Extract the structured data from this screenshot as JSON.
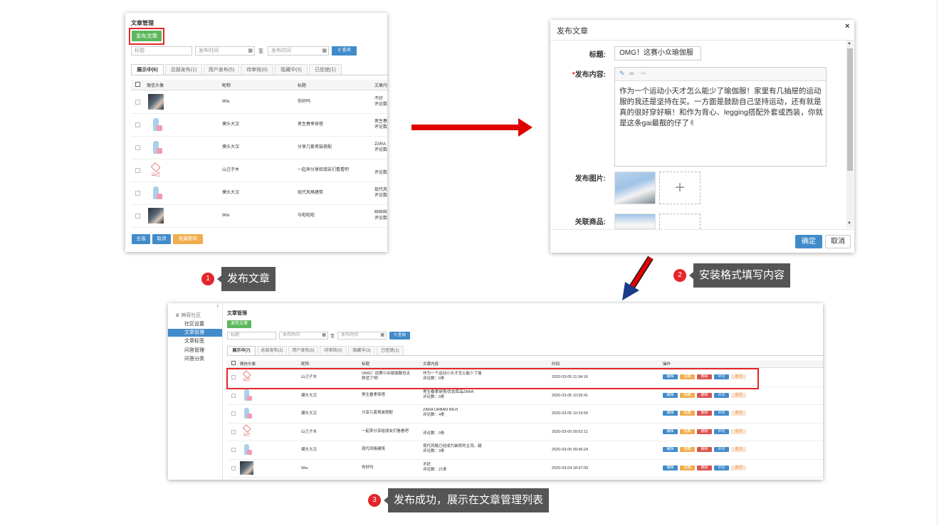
{
  "shot1": {
    "title": "文章管理",
    "publish_btn": "发布文章",
    "search_title_placeholder": "标题",
    "date_from_placeholder": "发布时间",
    "date_sep": "至",
    "date_to_placeholder": "发布时间",
    "query_btn": "查询",
    "tabs": [
      "展示中(6)",
      "总部发布(1)",
      "用户发布(5)",
      "待审核(0)",
      "隐藏中(3)",
      "已拒绝(1)"
    ],
    "headers": [
      "微信头像",
      "昵称",
      "标题",
      "文章内"
    ],
    "rows": [
      {
        "nick": "Ww.",
        "title": "你好吗",
        "content": "不好",
        "content2": "评论数"
      },
      {
        "nick": "摸头大汉",
        "title": "男生春季穿搭",
        "content": "男生春",
        "content2": "评论数"
      },
      {
        "nick": "摸头大汉",
        "title": "分享几套男装搭配",
        "content": "ZARA",
        "content2": "评论数"
      },
      {
        "nick": "山己子木",
        "title": "一起来分享给朋友们看看吧",
        "content": "",
        "content2": "评论数"
      },
      {
        "nick": "摸头大汉",
        "title": "现代风格建筑",
        "content": "现代风",
        "content2": "评论数"
      },
      {
        "nick": "Ww.",
        "title": "与啦啦啦",
        "content": "哔哔哔",
        "content2": "评论数"
      }
    ],
    "select_all": "全选",
    "cancel": "取消",
    "batch_delete": "批量删除"
  },
  "dialog": {
    "title": "发布文章",
    "close": "×",
    "title_label": "标题:",
    "title_value": "OMG！这赛小众瑜伽服",
    "content_label": "发布内容:",
    "content_req": "*",
    "content_text": "作为一个运动小天才怎么能少了瑜伽服！家里有几抽屉的运动服的我还是坚持在买。一方面是鼓励自己坚持运动，还有就是真的很好穿好嘛！和作为背心、legging搭配外套或西装，你就是这条gai最靓的仔了✌",
    "image_label": "发布图片:",
    "goods_label": "关联商品:",
    "plus": "+",
    "ok": "确定",
    "cancel": "取消"
  },
  "steps": [
    {
      "num": "1",
      "text": "发布文章"
    },
    {
      "num": "2",
      "text": "安装格式填写内容"
    },
    {
      "num": "3",
      "text": "发布成功，展示在文章管理列表"
    }
  ],
  "shot3": {
    "sidebar_header": "神奇社区",
    "sidebar_items": [
      "社区设置",
      "文章管理",
      "文章标签",
      "问答管理",
      "问答分类"
    ],
    "title": "文章管理",
    "publish_btn": "发布文章",
    "search_title_placeholder": "标题",
    "date_from_placeholder": "发布时间",
    "date_sep": "至",
    "date_to_placeholder": "发布时间",
    "query_btn": "查询",
    "tabs": [
      "展示中(7)",
      "总部发布(2)",
      "用户发布(5)",
      "待审核(0)",
      "隐藏中(3)",
      "已拒绝(1)"
    ],
    "headers": [
      "微信头像",
      "昵称",
      "标题",
      "文章内容",
      "时间",
      "操作"
    ],
    "actions": [
      "编辑",
      "隐藏",
      "删除",
      "评论",
      "置顶"
    ],
    "rows": [
      {
        "nick": "山己子木",
        "title": "OMG！这赛小众瑜伽服也太",
        "title2": "舒适了吧!",
        "content": "作为一个运动小天才怎么能少了瑜",
        "content2": "评论数：0条",
        "time": "2020-03-05 11:34:16"
      },
      {
        "nick": "摸头大汉",
        "title": "男生春季穿搭",
        "title2": "",
        "content": "男生春季穿搭/优衣库品ZARA",
        "content2": "评论数：0条",
        "time": "2020-03-05 10:35:41"
      },
      {
        "nick": "摸头大汉",
        "title": "分享几套男装搭配",
        "title2": "",
        "content": "ZARA URBAN REVI",
        "content2": "评论数：4条",
        "time": "2020-03-05 10:19:59"
      },
      {
        "nick": "山己子木",
        "title": "一起来分享给朋友们看看吧",
        "title2": "",
        "content": "",
        "content2": "评论数：0条",
        "time": "2020-03-05 09:52:11"
      },
      {
        "nick": "摸头大汉",
        "title": "现代风格建筑",
        "title2": "",
        "content": "现代风格已经成为装修的主流。越",
        "content2": "评论数：3条",
        "time": "2020-03-05 09:46:24"
      },
      {
        "nick": "Ww.",
        "title": "你好吗",
        "title2": "",
        "content": "不好",
        "content2": "评论数：21条",
        "time": "2020-03-04 18:37:09"
      }
    ]
  },
  "colors": {
    "green": "#5cb85c",
    "blue": "#428bca",
    "orange": "#f0ad4e",
    "red": "#e5252a",
    "arrow_red": "#e00000"
  }
}
